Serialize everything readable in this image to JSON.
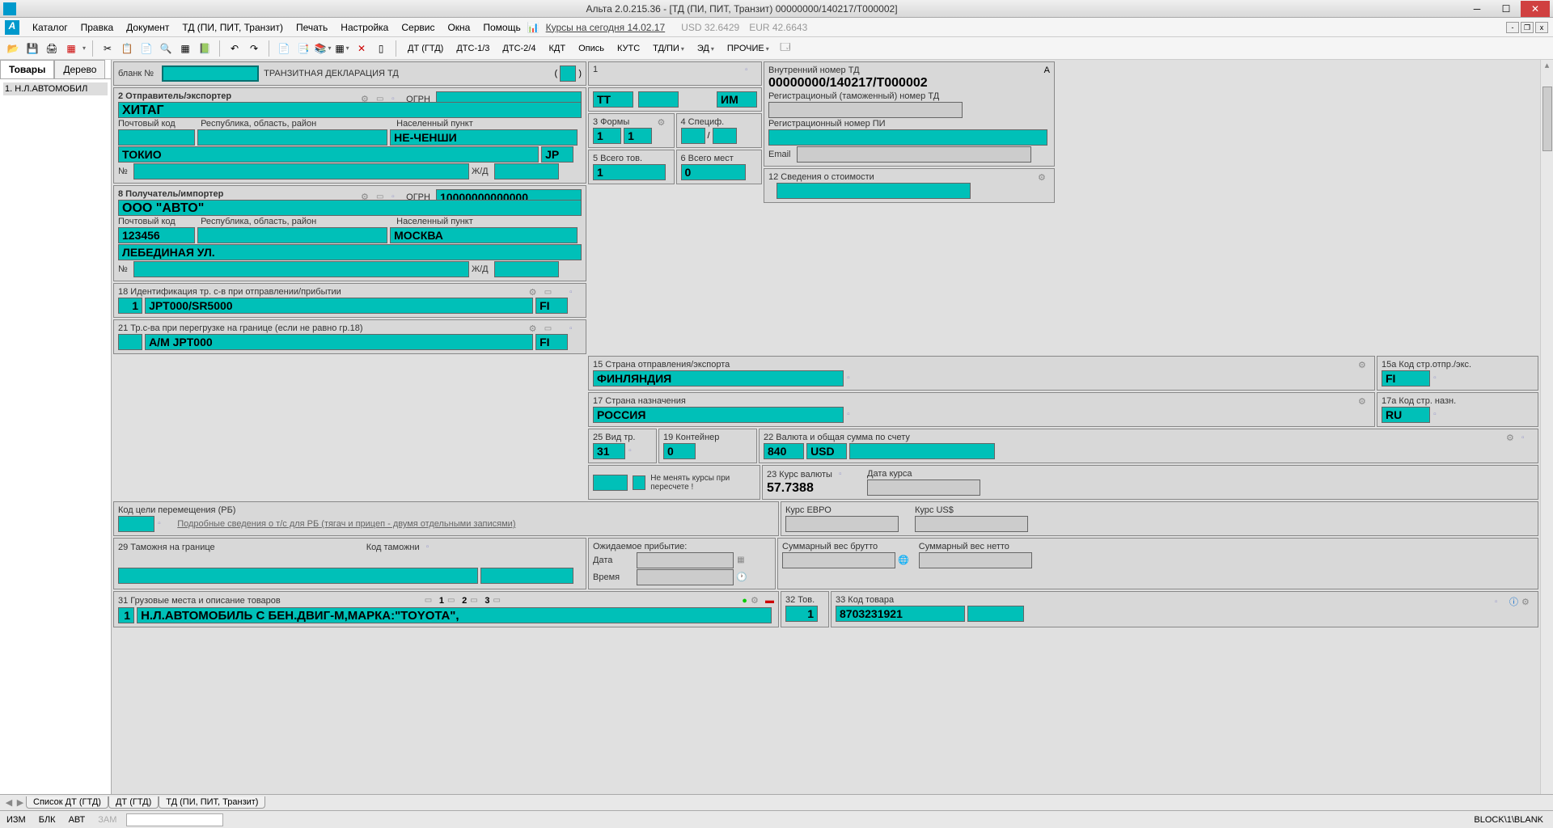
{
  "window": {
    "title": "Альта 2.0.215.36 - [ТД (ПИ, ПИТ, Транзит) 00000000/140217/Т000002]"
  },
  "menu": {
    "items": [
      "Каталог",
      "Правка",
      "Документ",
      "ТД (ПИ, ПИТ, Транзит)",
      "Печать",
      "Настройка",
      "Сервис",
      "Окна",
      "Помощь"
    ],
    "rates_label": "Курсы на сегодня 14.02.17",
    "usd": "USD 32.6429",
    "eur": "EUR 42.6643"
  },
  "toolbar2": {
    "dt": "ДТ (ГТД)",
    "dts13": "ДТС-1/3",
    "dts24": "ДТС-2/4",
    "kdt": "КДТ",
    "opis": "Опись",
    "kuts": "КУТС",
    "tdpi": "ТД/ПИ",
    "ed": "ЭД",
    "other": "ПРОЧИЕ"
  },
  "sidebar": {
    "tab1": "Товары",
    "tab2": "Дерево",
    "item1": "1. Н.Л.АВТОМОБИЛ"
  },
  "form": {
    "blank_label": "бланк №",
    "blank_val": "",
    "decl_type": "ТРАНЗИТНАЯ ДЕКЛАРАЦИЯ   ТД",
    "internal_label": "Внутренний номер ТД",
    "internal_val": "00000000/140217/Т000002",
    "reg_customs_label": "Регистрационый (таможенный) номер ТД",
    "reg_pi_label": "Регистрационный номер ПИ",
    "email_label": "Email",
    "box1": "1",
    "box1_tt": "ТТ",
    "box1_im": "ИМ",
    "box2_label": "2 Отправитель/экспортер",
    "ogrn_label": "ОГРН",
    "sender_name": "ХИТАГ",
    "postal_label": "Почтовый код",
    "region_label": "Республика, область, район",
    "city_label": "Населенный пункт",
    "sender_postal": "ТОКИО",
    "sender_city": "НЕ-ЧЕНШИ",
    "sender_country": "JP",
    "num_label": "№",
    "zhd_label": "Ж/Д",
    "box3_label": "3 Формы",
    "box3_a": "1",
    "box3_b": "1",
    "box4_label": "4 Специф.",
    "box5_label": "5 Всего тов.",
    "box5_val": "1",
    "box6_label": "6 Всего мест",
    "box6_val": "0",
    "box8_label": "8 Получатель/импортер",
    "recv_ogrn": "10000000000000",
    "recv_name": "ООО \"АВТО\"",
    "recv_postal": "123456",
    "recv_city": "МОСКВА",
    "recv_street": "ЛЕБЕДИНАЯ УЛ.",
    "box12_label": "12 Сведения о стоимости",
    "box15_label": "15 Страна отправления/экспорта",
    "box15_val": "ФИНЛЯНДИЯ",
    "box15a_label": "15а Код стр.отпр./экс.",
    "box15a_val": "FI",
    "box17_label": "17 Страна назначения",
    "box17_val": "РОССИЯ",
    "box17a_label": "17а Код стр. назн.",
    "box17a_val": "RU",
    "box18_label": "18 Идентификация тр. с-в при отправлении/прибытии",
    "box18_count": "1",
    "box18_val": "JPT000/SR5000",
    "box18_cc": "FI",
    "box21_label": "21 Тр.с-ва при перегрузке на границе (если не равно гр.18)",
    "box21_val": "А/М JPT000",
    "box21_cc": "FI",
    "box22_label": "22 Валюта и общая сумма по счету",
    "box22_code": "840",
    "box22_name": "USD",
    "box23_label": "23 Курс валюты",
    "box23_val": "57.7388",
    "rate_date_label": "Дата курса",
    "rate_eur_label": "Курс ЕВРО",
    "rate_usd_label": "Курс US$",
    "box25_label": "25 Вид тр.",
    "box25_val": "31",
    "box19_label": "19 Контейнер",
    "box19_val": "0",
    "no_change_rates": "Не менять курсы при пересчете !",
    "purpose_label": "Код цели перемещения (РБ)",
    "purpose_link": "Подробные сведения о т/с для РБ (тягач и прицеп - двумя отдельными записями)",
    "box29_label": "29 Таможня на границе",
    "customs_code_label": "Код таможни",
    "expected_label": "Ожидаемое прибытие:",
    "date_label": "Дата",
    "time_label": "Время",
    "gross_label": "Суммарный вес брутто",
    "net_label": "Суммарный вес нетто",
    "box31_label": "31 Грузовые места и описание товаров",
    "box31_num": "1",
    "box31_val": "Н.Л.АВТОМОБИЛЬ С БЕН.ДВИГ-М,МАРКА:\"TOYOTA\",",
    "box31_1": "1",
    "box31_2": "2",
    "box31_3": "3",
    "box32_label": "32 Тов.",
    "box32_val": "1",
    "box33_label": "33 Код товара",
    "box33_val": "8703231921",
    "A_mark": "А"
  },
  "bottom_tabs": {
    "t1": "Список ДТ (ГТД)",
    "t2": "ДТ (ГТД)",
    "t3": "ТД (ПИ, ПИТ, Транзит)"
  },
  "status": {
    "izm": "ИЗМ",
    "blk": "БЛК",
    "avt": "АВТ",
    "zam": "ЗАМ",
    "path": "BLOCK\\1\\BLANK"
  }
}
